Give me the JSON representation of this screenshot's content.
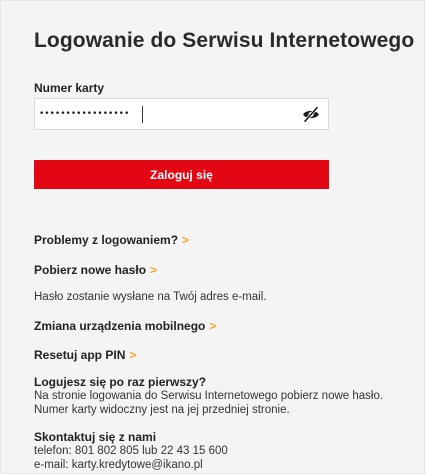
{
  "login": {
    "title": "Logowanie do Serwisu Internetowego",
    "card_label": "Numer karty",
    "card_value": "•••••••••••••••••",
    "submit_label": "Zaloguj się"
  },
  "links": {
    "problems": "Problemy z logowaniem?",
    "new_password": "Pobierz nowe hasło",
    "password_note": "Hasło zostanie wysłane na Twój adres e-mail.",
    "change_device": "Zmiana urządzenia mobilnego",
    "reset_pin": "Resetuj app PIN",
    "chevron": ">"
  },
  "first_login": {
    "title": "Logujesz się po raz pierwszy?",
    "line1": "Na stronie logowania do Serwisu Internetowego pobierz nowe hasło.",
    "line2": "Numer karty widoczny jest na jej przedniej stronie."
  },
  "contact": {
    "title": "Skontaktuj się z nami",
    "phone": "telefon: 801 802 805 lub 22 43 15 600",
    "email": "e-mail: karty.kredytowe@ikano.pl"
  },
  "colors": {
    "accent": "#e30613",
    "chevron": "#f5a623",
    "panel_bg": "#f4f4f4"
  },
  "icons": {
    "visibility_toggle": "eye-off-icon"
  }
}
